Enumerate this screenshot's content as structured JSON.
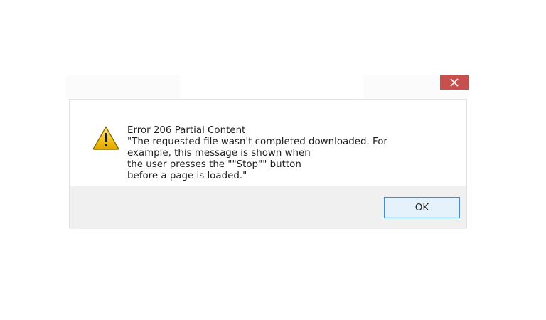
{
  "dialog": {
    "close_icon": "close-icon",
    "warning_icon": "warning-icon",
    "message_lines": [
      "Error 206 Partial Content",
      "\"The requested file wasn't completed downloaded. For",
      "example, this message is shown when",
      "the user presses the \"\"Stop\"\" button",
      "before a page is loaded.\""
    ],
    "ok_label": "OK"
  },
  "colors": {
    "close_button_bg": "#c7504f",
    "button_region_bg": "#f0f0f0",
    "ok_border": "#3c8ed8",
    "warning_yellow": "#f5c518"
  }
}
